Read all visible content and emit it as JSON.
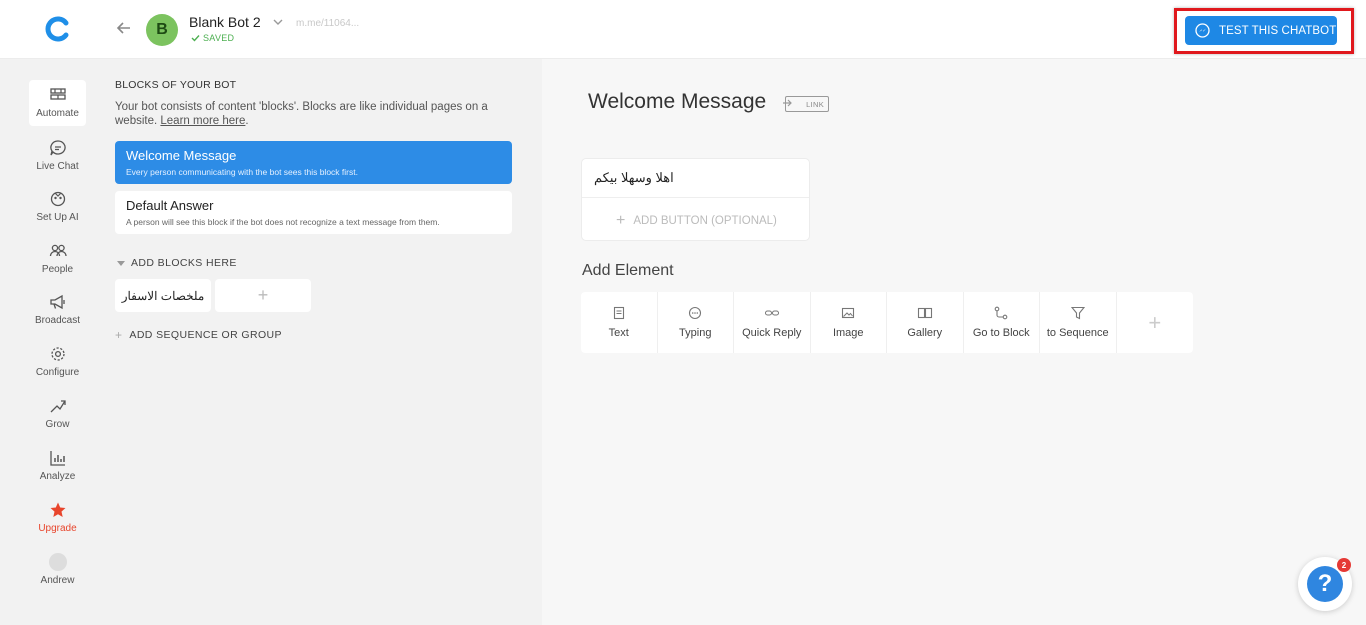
{
  "header": {
    "avatar_letter": "B",
    "bot_name": "Blank Bot 2",
    "saved_label": "SAVED",
    "page_link": "m.me/11064...",
    "test_button": "TEST THIS CHATBOT",
    "accent": "#1e88e5",
    "highlight": "#e0181d"
  },
  "sidebar": {
    "items": [
      {
        "label": "Automate",
        "icon": "automate-icon"
      },
      {
        "label": "Live Chat",
        "icon": "chat-icon"
      },
      {
        "label": "Set Up AI",
        "icon": "ai-icon"
      },
      {
        "label": "People",
        "icon": "people-icon"
      },
      {
        "label": "Broadcast",
        "icon": "megaphone-icon"
      },
      {
        "label": "Configure",
        "icon": "gear-icon"
      },
      {
        "label": "Grow",
        "icon": "grow-icon"
      },
      {
        "label": "Analyze",
        "icon": "chart-icon"
      },
      {
        "label": "Upgrade",
        "icon": "star-icon"
      },
      {
        "label": "Andrew",
        "icon": "user-avatar"
      }
    ]
  },
  "blocks_panel": {
    "title": "BLOCKS OF YOUR BOT",
    "description": "Your bot consists of content 'blocks'. Blocks are like individual pages on a website.",
    "learn_more": "Learn more here",
    "blocks": [
      {
        "title": "Welcome Message",
        "desc": "Every person communicating with the bot sees this block first."
      },
      {
        "title": "Default Answer",
        "desc": "A person will see this block if the bot does not recognize a text message from them."
      }
    ],
    "add_blocks_label": "ADD BLOCKS HERE",
    "custom_blocks": [
      "ملخصات الاسفار"
    ],
    "add_sequence_label": "ADD SEQUENCE OR GROUP"
  },
  "editor": {
    "title": "Welcome Message",
    "link_tag": "LINK",
    "message_text": "اهلا وسهلا بيكم",
    "add_button": "ADD BUTTON (OPTIONAL)",
    "add_element_label": "Add Element",
    "elements": [
      "Text",
      "Typing",
      "Quick Reply",
      "Image",
      "Gallery",
      "Go to Block",
      "to Sequence"
    ]
  },
  "help": {
    "badge_count": "2",
    "symbol": "?"
  }
}
